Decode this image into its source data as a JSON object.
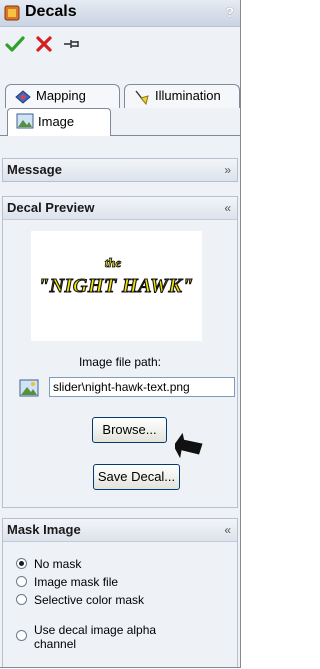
{
  "window": {
    "title": "Decals",
    "help": "?"
  },
  "actions": {
    "ok": "check-icon",
    "cancel": "x-icon",
    "pin": "pushpin-icon"
  },
  "tabs": [
    {
      "label": "Mapping",
      "icon": "mapping-icon"
    },
    {
      "label": "Illumination",
      "icon": "illumination-icon"
    },
    {
      "label": "Image",
      "icon": "image-icon",
      "active": true
    }
  ],
  "sections": {
    "message": {
      "title": "Message",
      "state": "collapsed"
    },
    "preview": {
      "title": "Decal Preview",
      "state": "expanded",
      "decal_text_the": "the",
      "decal_text_main": "\"NIGHT HAWK\"",
      "path_label": "Image file path:",
      "path_value": "slider\\night-hawk-text.png",
      "browse_label": "Browse...",
      "save_label": "Save Decal..."
    },
    "mask": {
      "title": "Mask Image",
      "state": "expanded",
      "options": [
        {
          "label": "No mask",
          "selected": true
        },
        {
          "label": "Image mask file",
          "selected": false
        },
        {
          "label": "Selective color mask",
          "selected": false
        },
        {
          "label": "Use decal image alpha channel",
          "selected": false
        }
      ]
    }
  },
  "colors": {
    "decal_yellow": "#f4e600",
    "decal_outline": "#111111",
    "ok_green": "#2ea12e",
    "cancel_red": "#d42020"
  }
}
